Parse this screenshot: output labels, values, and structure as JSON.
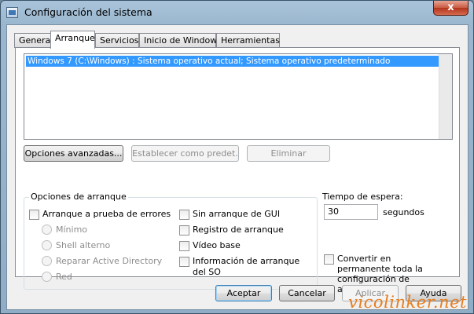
{
  "window": {
    "title": "Configuración del sistema",
    "close_glyph": "x"
  },
  "tabs": [
    {
      "label": "General"
    },
    {
      "label": "Arranque"
    },
    {
      "label": "Servicios"
    },
    {
      "label": "Inicio de Windows"
    },
    {
      "label": "Herramientas"
    }
  ],
  "os_list": {
    "items": [
      "Windows 7 (C:\\Windows) : Sistema operativo actual; Sistema operativo predeterminado"
    ]
  },
  "list_buttons": {
    "advanced": "Opciones avanzadas...",
    "set_default": "Establecer como predet.",
    "delete": "Eliminar"
  },
  "boot_options": {
    "label": "Opciones de arranque",
    "safe_boot": "Arranque a prueba de errores",
    "minimal": "Mínimo",
    "alternate_shell": "Shell alterno",
    "active_directory": "Reparar Active Directory",
    "network": "Red",
    "no_gui": "Sin arranque de GUI",
    "boot_log": "Registro de arranque",
    "base_video": "Vídeo base",
    "os_boot_info": "Información de arranque del SO"
  },
  "timeout": {
    "label": "Tiempo de espera:",
    "value": "30",
    "unit": "segundos"
  },
  "make_permanent": "Convertir en permanente toda la configuración de arranque",
  "footer": {
    "ok": "Aceptar",
    "cancel": "Cancelar",
    "apply": "Aplicar",
    "help": "Ayuda"
  },
  "watermark": "vicolinker.net"
}
